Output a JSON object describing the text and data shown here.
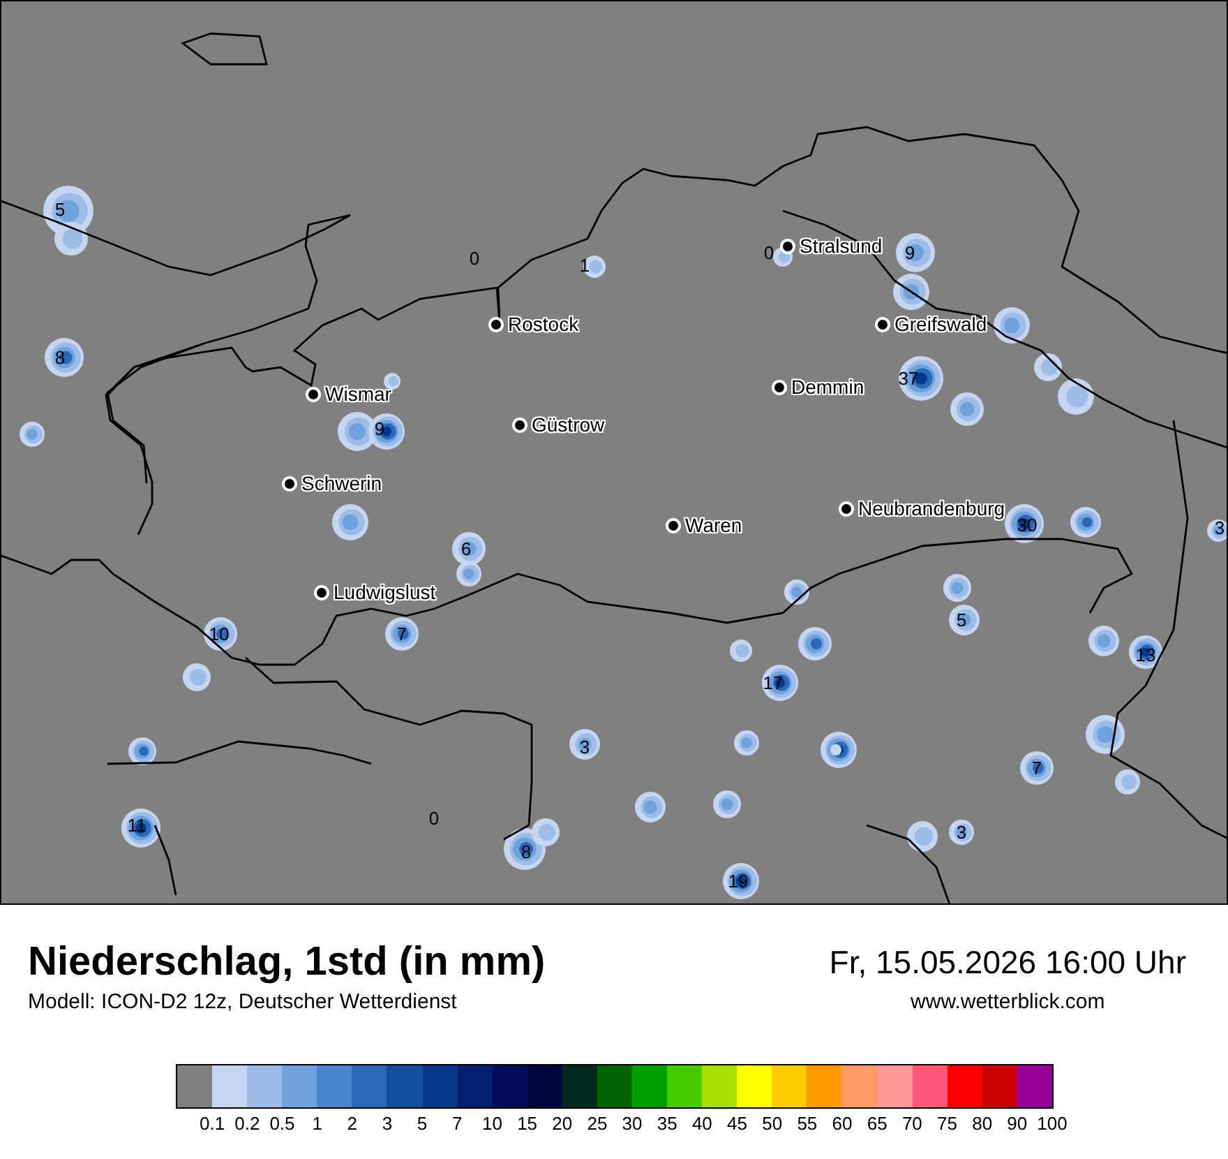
{
  "map": {
    "cities": [
      {
        "name": "Stralsund"
      },
      {
        "name": "Rostock"
      },
      {
        "name": "Greifswald"
      },
      {
        "name": "Wismar"
      },
      {
        "name": "Demmin"
      },
      {
        "name": "Güstrow"
      },
      {
        "name": "Schwerin"
      },
      {
        "name": "Neubrandenburg"
      },
      {
        "name": "Waren"
      },
      {
        "name": "Ludwigslust"
      }
    ],
    "value_labels": [
      "5",
      "0",
      "1",
      "8",
      "9",
      "0",
      "9",
      "37",
      "30",
      "3",
      "6",
      "10",
      "7",
      "5",
      "13",
      "17",
      "3",
      "7",
      "0",
      "11",
      "8",
      "3",
      "19"
    ]
  },
  "header": {
    "title": "Niederschlag, 1std (in mm)",
    "model": "Modell: ICON-D2 12z, Deutscher Wetterdienst",
    "datetime": "Fr, 15.05.2026 16:00 Uhr",
    "website": "www.wetterblick.com"
  },
  "legend": {
    "bins": [
      {
        "color": "#808080"
      },
      {
        "color": "#c6d6f0"
      },
      {
        "color": "#9dbde8"
      },
      {
        "color": "#6fa2dc"
      },
      {
        "color": "#4a84cc"
      },
      {
        "color": "#2a68b8"
      },
      {
        "color": "#1150a0"
      },
      {
        "color": "#05388a"
      },
      {
        "color": "#032070"
      },
      {
        "color": "#020c5a"
      },
      {
        "color": "#000640"
      },
      {
        "color": "#002a20"
      },
      {
        "color": "#006400"
      },
      {
        "color": "#00a000"
      },
      {
        "color": "#44cc00"
      },
      {
        "color": "#a8e000"
      },
      {
        "color": "#ffff00"
      },
      {
        "color": "#ffcc00"
      },
      {
        "color": "#ff9900"
      },
      {
        "color": "#ff9966"
      },
      {
        "color": "#ff9999"
      },
      {
        "color": "#ff5577"
      },
      {
        "color": "#ff0000"
      },
      {
        "color": "#cc0000"
      },
      {
        "color": "#990099"
      }
    ],
    "ticks": [
      "0.1",
      "0.2",
      "0.5",
      "1",
      "2",
      "3",
      "5",
      "7",
      "10",
      "15",
      "20",
      "25",
      "30",
      "35",
      "40",
      "45",
      "50",
      "55",
      "60",
      "65",
      "70",
      "75",
      "80",
      "90",
      "100"
    ]
  }
}
